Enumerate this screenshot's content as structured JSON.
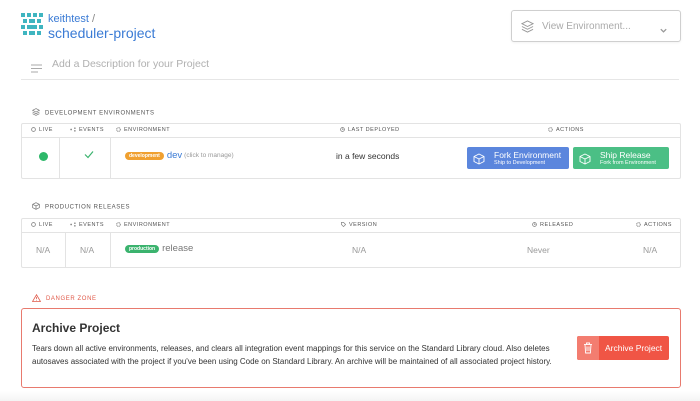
{
  "header": {
    "owner": "keithtest",
    "separator": "/",
    "project": "scheduler-project",
    "environment_select": {
      "placeholder": "View Environment..."
    },
    "description_placeholder": "Add a Description for your Project"
  },
  "dev_section": {
    "title": "DEVELOPMENT ENVIRONMENTS",
    "columns": {
      "live": "LIVE",
      "events": "EVENTS",
      "environment": "ENVIRONMENT",
      "last_deployed": "LAST DEPLOYED",
      "actions": "ACTIONS"
    },
    "row": {
      "badge": "development",
      "name": "dev",
      "manage": "(click to manage)",
      "last_deployed": "in a few seconds",
      "fork": {
        "title": "Fork Environment",
        "subtitle": "Ship to Development"
      },
      "ship": {
        "title": "Ship Release",
        "subtitle": "Fork from Environment"
      }
    }
  },
  "prod_section": {
    "title": "PRODUCTION RELEASES",
    "columns": {
      "live": "LIVE",
      "events": "EVENTS",
      "environment": "ENVIRONMENT",
      "version": "VERSION",
      "released": "RELEASED",
      "actions": "ACTIONS"
    },
    "row": {
      "live": "N/A",
      "events": "N/A",
      "badge": "production",
      "name": "release",
      "version": "N/A",
      "released": "Never",
      "actions": "N/A"
    }
  },
  "danger_zone": {
    "title": "DANGER ZONE",
    "heading": "Archive Project",
    "body": "Tears down all active environments, releases, and clears all integration event mappings for this service on the Standard Library cloud. Also deletes autosaves associated with the project if you've been using Code on Standard Library. An archive will be maintained of all associated project history.",
    "button": "Archive Project"
  },
  "colors": {
    "accent_blue": "#3a7bd5",
    "fork_button": "#5b86dd",
    "ship_button": "#4bbf85",
    "live_green": "#2eb86a",
    "dev_badge": "#f0a030",
    "prod_badge": "#3bb36e",
    "danger": "#f05545"
  },
  "icons": [
    "logo-icon",
    "layers-icon",
    "chevron-down-icon",
    "description-lines-icon",
    "cube-icon",
    "check-icon",
    "warning-icon",
    "trash-icon",
    "circle-icon",
    "network-icon",
    "gear-icon",
    "tag-icon",
    "clock-icon"
  ]
}
